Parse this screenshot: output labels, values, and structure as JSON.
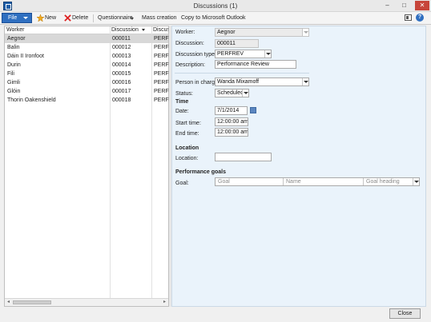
{
  "window": {
    "title": "Discussions (1)",
    "minimize": "–",
    "maximize": "□",
    "close": "✕"
  },
  "actionpane": {
    "file": "File",
    "new": "New",
    "delete": "Delete",
    "questionnaire": "Questionnaire",
    "mass_creation": "Mass creation",
    "copy_outlook": "Copy to Microsoft Outlook",
    "help": "?"
  },
  "grid": {
    "headers": [
      "Worker",
      "Discussion",
      "Discuss"
    ],
    "rows": [
      {
        "worker": "Aegnor",
        "discussion": "000011",
        "perf": "PERFRE"
      },
      {
        "worker": "Balin",
        "discussion": "000012",
        "perf": "PERFRE"
      },
      {
        "worker": "Dáin II Ironfoot",
        "discussion": "000013",
        "perf": "PERFRE"
      },
      {
        "worker": "Durin",
        "discussion": "000014",
        "perf": "PERFRE"
      },
      {
        "worker": "Fili",
        "discussion": "000015",
        "perf": "PERFRE"
      },
      {
        "worker": "Gimli",
        "discussion": "000016",
        "perf": "PERFRE"
      },
      {
        "worker": "Glóin",
        "discussion": "000017",
        "perf": "PERFRE"
      },
      {
        "worker": "Thorin Oakenshield",
        "discussion": "000018",
        "perf": "PERFRE"
      }
    ],
    "scroll_left": "◂",
    "scroll_right": "▸"
  },
  "details": {
    "worker_label": "Worker:",
    "worker_value": "Aegnor",
    "discussion_label": "Discussion:",
    "discussion_value": "000011",
    "type_label": "Discussion type:",
    "type_value": "PERFREV",
    "description_label": "Description:",
    "description_value": "Performance Review",
    "person_label": "Person in charge:",
    "person_value": "Wanda Mixamoff",
    "status_label": "Status:",
    "status_value": "Scheduled",
    "time_section": "Time",
    "date_label": "Date:",
    "date_value": "7/1/2014",
    "start_label": "Start time:",
    "start_value": "12:00:00 am",
    "end_label": "End time:",
    "end_value": "12:00:00 am",
    "location_section": "Location",
    "location_label": "Location:",
    "location_value": "",
    "goals_section": "Performance goals",
    "goal_label": "Goal:",
    "goal_ph": "Goal",
    "name_ph": "Name",
    "heading_ph": "Goal heading"
  },
  "footer": {
    "close": "Close"
  }
}
